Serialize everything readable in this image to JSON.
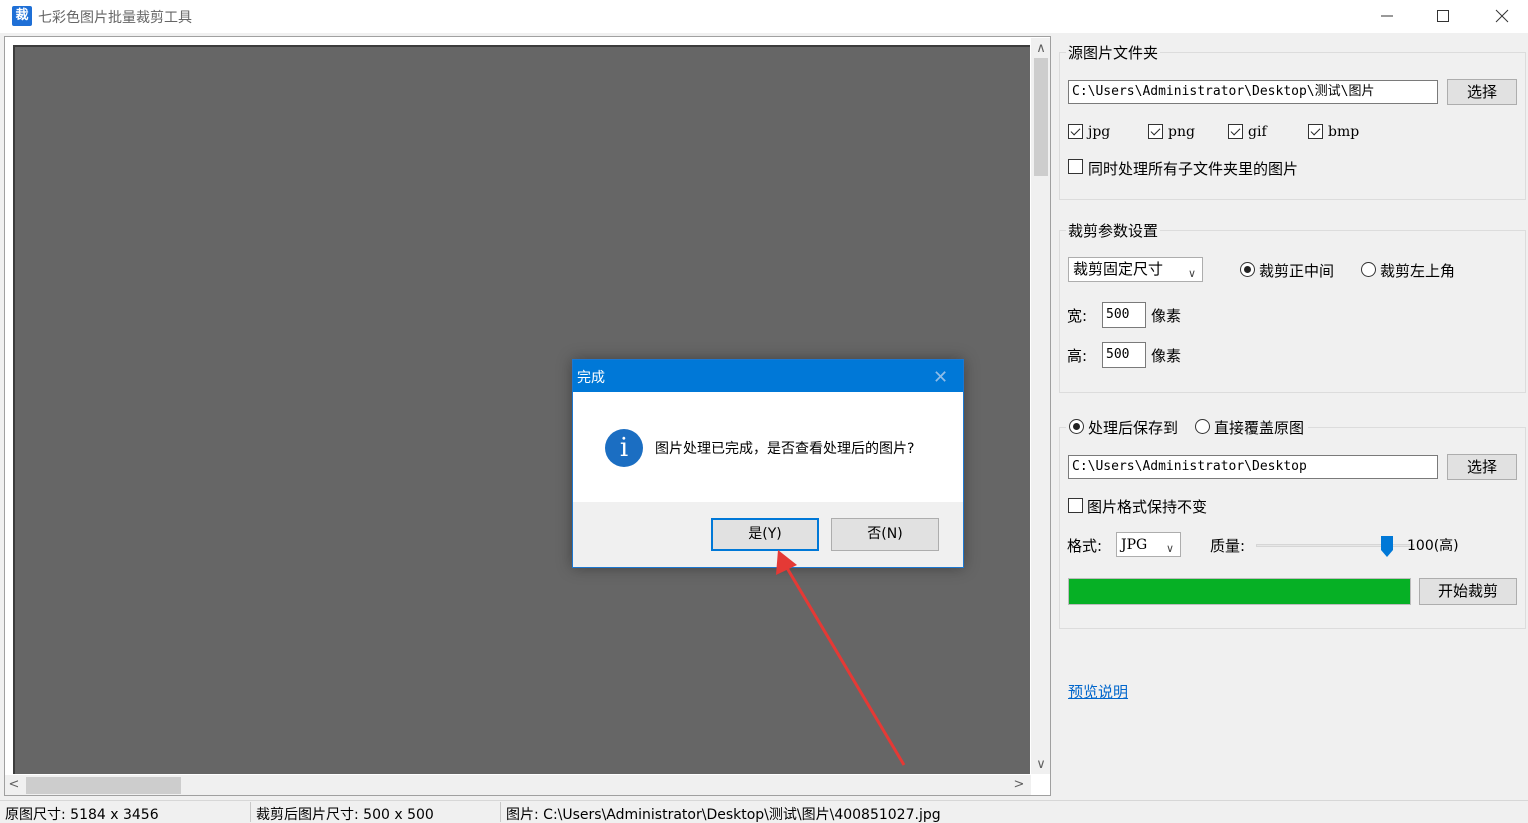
{
  "window": {
    "icon_char": "裁",
    "title": "七彩色图片批量裁剪工具"
  },
  "source": {
    "legend": "源图片文件夹",
    "path": "C:\\Users\\Administrator\\Desktop\\测试\\图片",
    "select_label": "选择",
    "types": [
      {
        "label": "jpg",
        "checked": true
      },
      {
        "label": "png",
        "checked": true
      },
      {
        "label": "gif",
        "checked": true
      },
      {
        "label": "bmp",
        "checked": true
      }
    ],
    "subfolders_label": "同时处理所有子文件夹里的图片",
    "subfolders_checked": false
  },
  "crop": {
    "legend": "裁剪参数设置",
    "mode_value": "裁剪固定尺寸",
    "center_label": "裁剪正中间",
    "center_selected": true,
    "topleft_label": "裁剪左上角",
    "width_label": "宽:",
    "width_value": "500",
    "height_label": "高:",
    "height_value": "500",
    "unit": "像素"
  },
  "output": {
    "save_to_label": "处理后保存到",
    "save_to_selected": true,
    "overwrite_label": "直接覆盖原图",
    "path": "C:\\Users\\Administrator\\Desktop",
    "select_label": "选择",
    "keep_format_label": "图片格式保持不变",
    "keep_format_checked": false,
    "format_label": "格式:",
    "format_value": "JPG",
    "quality_label": "质量:",
    "quality_value": 100,
    "quality_text": "100(高)",
    "progress_percent": 100,
    "progress_color": "#06b025",
    "start_label": "开始裁剪"
  },
  "help_link": "预览说明",
  "status": {
    "original_size": "原图尺寸: 5184 x 3456",
    "cropped_size": "裁剪后图片尺寸: 500 x 500",
    "image_path": "图片: C:\\Users\\Administrator\\Desktop\\测试\\图片\\400851027.jpg"
  },
  "dialog": {
    "title": "完成",
    "icon": "info-icon",
    "message": "图片处理已完成，是否查看处理后的图片?",
    "yes_label": "是(Y)",
    "no_label": "否(N)"
  },
  "annotation": {
    "color": "#e53935"
  }
}
